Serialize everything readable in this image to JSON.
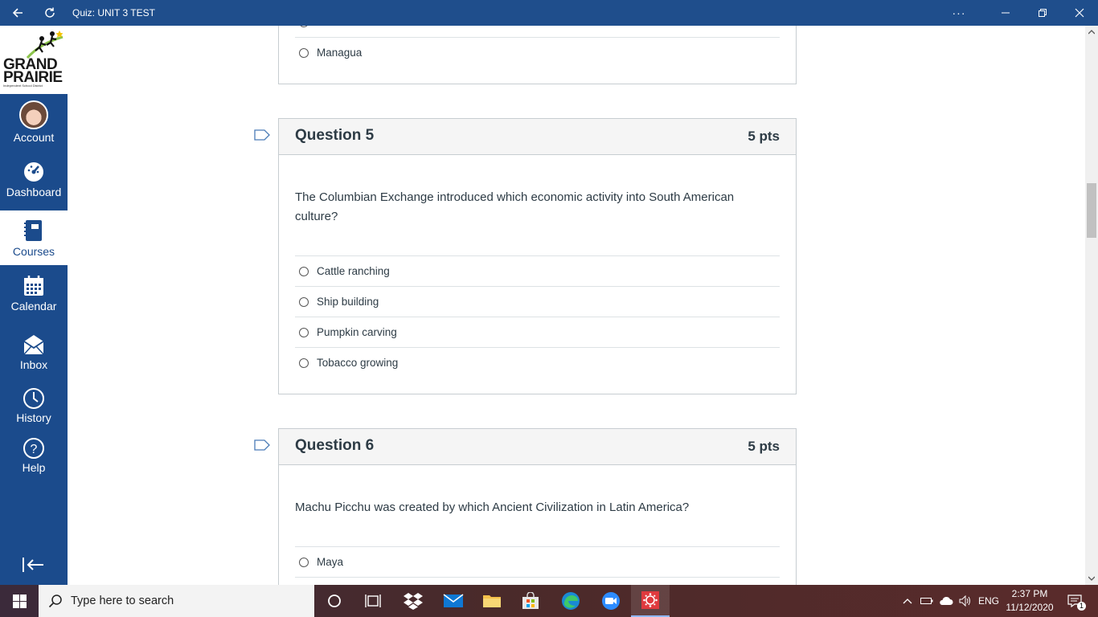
{
  "titlebar": {
    "title": "Quiz: UNIT 3 TEST",
    "more_label": "···"
  },
  "logo": {
    "line1": "GRAND",
    "line2": "PRAIRIE",
    "tagline": "Independent School District"
  },
  "nav": {
    "items": [
      {
        "label": "Account",
        "icon": "avatar"
      },
      {
        "label": "Dashboard",
        "icon": "dashboard-icon"
      },
      {
        "label": "Courses",
        "icon": "courses-icon"
      },
      {
        "label": "Calendar",
        "icon": "calendar-icon"
      },
      {
        "label": "Inbox",
        "icon": "inbox-icon"
      },
      {
        "label": "History",
        "icon": "history-icon"
      },
      {
        "label": "Help",
        "icon": "help-icon"
      }
    ],
    "active": "Courses"
  },
  "questions": [
    {
      "partial": true,
      "answers": [
        "Managua"
      ]
    },
    {
      "title": "Question 5",
      "points": "5 pts",
      "text": "The Columbian Exchange introduced which economic activity into South American culture?",
      "answers": [
        "Cattle ranching",
        "Ship building",
        "Pumpkin carving",
        "Tobacco growing"
      ]
    },
    {
      "title": "Question 6",
      "points": "5 pts",
      "text": "Machu Picchu was created by which Ancient Civilization in Latin America?",
      "answers": [
        "Maya"
      ]
    }
  ],
  "taskbar": {
    "search_placeholder": "Type here to search",
    "language": "ENG",
    "time": "2:37 PM",
    "date": "11/12/2020",
    "notification_count": "1"
  },
  "colors": {
    "titlebar": "#1f4e8c",
    "nav": "#1b4b8c",
    "card_border": "#c7cdd1",
    "card_header": "#f5f5f5"
  }
}
